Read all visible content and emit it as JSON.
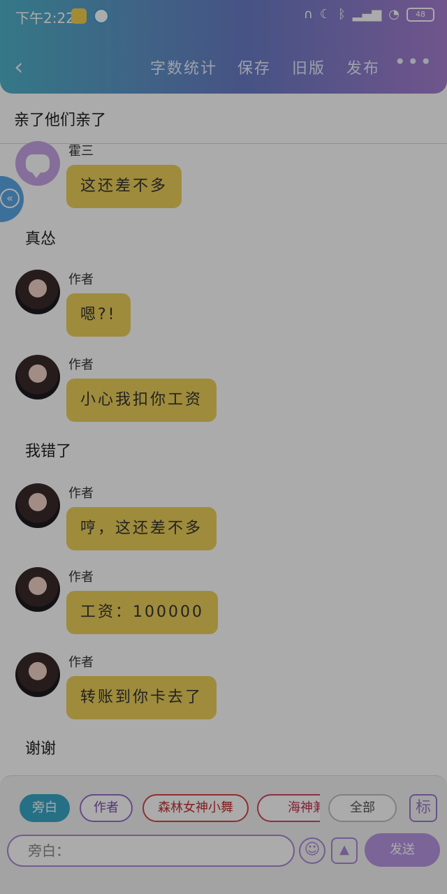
{
  "status": {
    "time": "下午2:22",
    "battery": "48"
  },
  "nav": {
    "back": "‹",
    "items": [
      "字数统计",
      "保存",
      "旧版",
      "发布"
    ],
    "more": "•••"
  },
  "title": "亲了他们亲了",
  "messages": [
    {
      "name": "霍三",
      "text": "这还差不多"
    },
    {
      "name": "作者",
      "text": "嗯?!"
    },
    {
      "name": "作者",
      "text": "小心我扣你工资"
    },
    {
      "name": "作者",
      "text": "哼，这还差不多"
    },
    {
      "name": "作者",
      "text": "工资：100000"
    },
    {
      "name": "作者",
      "text": "转账到你卡去了"
    }
  ],
  "narrations": [
    "真怂",
    "我错了",
    "谢谢"
  ],
  "bottom": {
    "chips": [
      "旁白",
      "作者",
      "森林女神小舞",
      "海神兼任"
    ],
    "all": "全部",
    "mark": "标",
    "placeholder": "旁白：",
    "send": "发送"
  },
  "colors": {
    "header_start": "#4fb3c9",
    "header_end": "#a77fd1",
    "bubble": "#ecd05a",
    "accent": "#a98ad8"
  }
}
